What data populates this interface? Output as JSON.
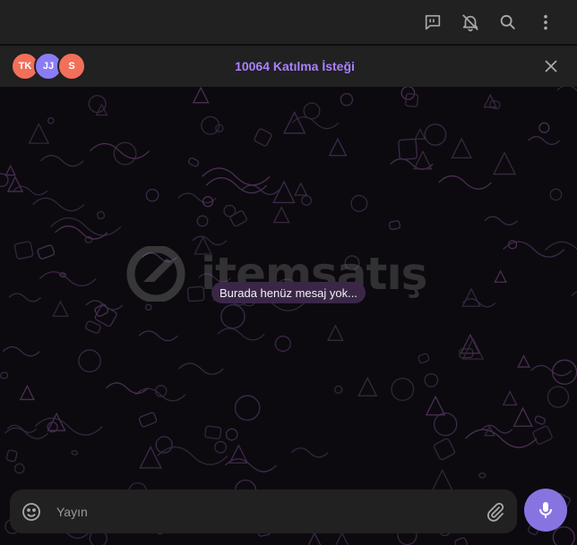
{
  "topbar": {
    "icons": [
      "chat-bubble-icon",
      "mute-bell-icon",
      "search-icon",
      "more-vertical-icon"
    ]
  },
  "join_bar": {
    "avatars": [
      {
        "initials": "TK",
        "color": "#f26f5a"
      },
      {
        "initials": "JJ",
        "color": "#8b7cf6"
      },
      {
        "initials": "S",
        "color": "#f26f5a"
      }
    ],
    "label": "10064 Katılma İsteği",
    "accent": "#a981ff"
  },
  "chat": {
    "empty_text": "Burada henüz mesaj yok...",
    "watermark": "itemsatış"
  },
  "composer": {
    "placeholder": "Yayın",
    "mic_color": "#8774e1"
  }
}
